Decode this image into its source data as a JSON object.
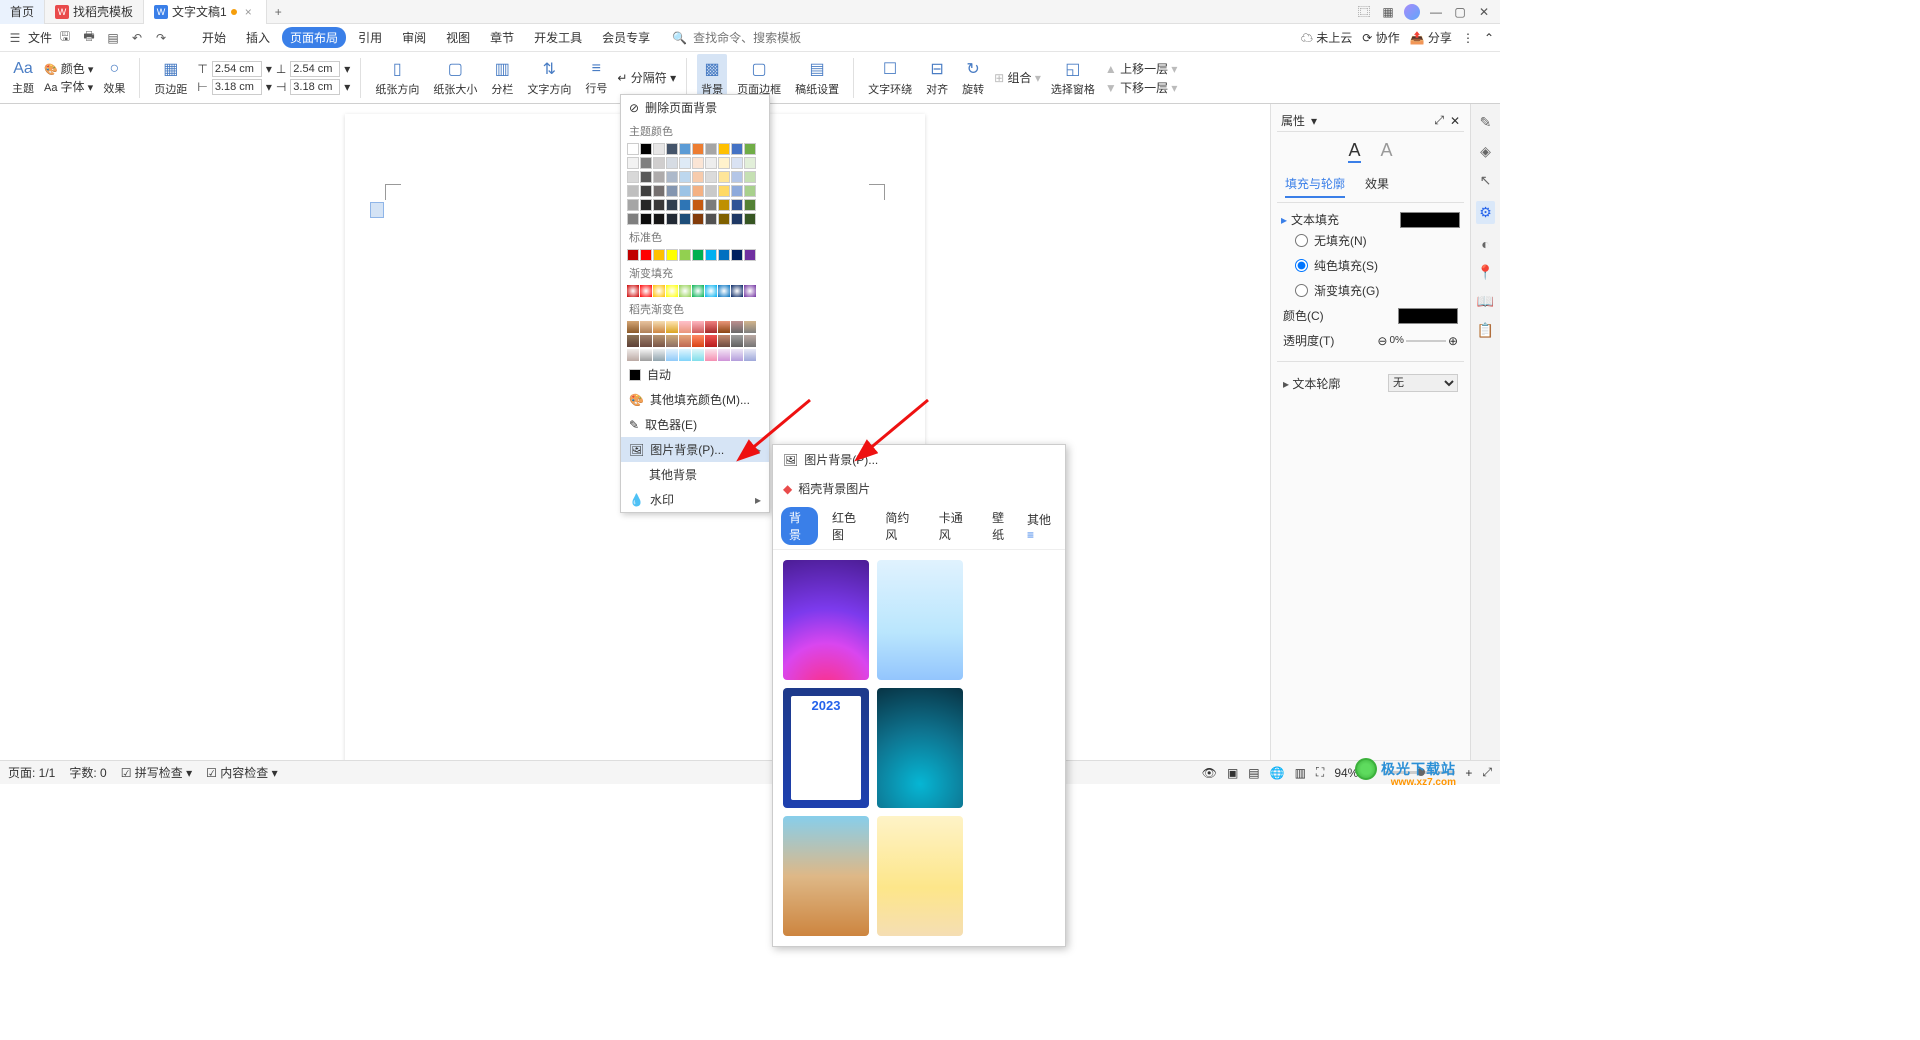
{
  "tabs": {
    "home": "首页",
    "template": "找稻壳模板",
    "doc": "文字文稿1"
  },
  "menu": {
    "file": "文件",
    "start": "开始",
    "insert": "插入",
    "layout": "页面布局",
    "ref": "引用",
    "review": "审阅",
    "view": "视图",
    "chapter": "章节",
    "dev": "开发工具",
    "member": "会员专享"
  },
  "search": {
    "cmd": "查找命令、搜索模板"
  },
  "cloud": {
    "nosave": "未上云",
    "collab": "协作",
    "share": "分享"
  },
  "ribbon": {
    "theme": "主题",
    "color": "颜色",
    "font": "字体",
    "effect": "效果",
    "margin": "页边距",
    "top": "2.54 cm",
    "bottom": "2.54 cm",
    "left": "3.18 cm",
    "right": "3.18 cm",
    "orient": "纸张方向",
    "size": "纸张大小",
    "columns": "分栏",
    "textdir": "文字方向",
    "lineno": "行号",
    "breaks": "分隔符",
    "bg": "背景",
    "border": "页面边框",
    "paper": "稿纸设置",
    "wrap": "文字环绕",
    "align": "对齐",
    "rotate": "旋转",
    "group": "组合",
    "pane": "选择窗格",
    "forward": "上移一层",
    "backward": "下移一层"
  },
  "bgmenu": {
    "delete": "删除页面背景",
    "theme": "主题颜色",
    "standard": "标准色",
    "gradient": "渐变填充",
    "docer": "稻壳渐变色",
    "auto": "自动",
    "more": "其他填充颜色(M)...",
    "picker": "取色器(E)",
    "image": "图片背景(P)...",
    "other": "其他背景",
    "watermark": "水印"
  },
  "submenu": {
    "image": "图片背景(P)...",
    "docer": "稻壳背景图片",
    "cat_bg": "背景",
    "cat_red": "红色图",
    "cat_simple": "简约风",
    "cat_cartoon": "卡通风",
    "cat_wall": "壁纸",
    "other": "其他",
    "year": "2023"
  },
  "panel": {
    "title": "属性",
    "tab_fill": "填充与轮廓",
    "tab_effect": "效果",
    "sect_fill": "文本填充",
    "r_none": "无填充(N)",
    "r_solid": "纯色填充(S)",
    "r_grad": "渐变填充(G)",
    "color": "颜色(C)",
    "trans": "透明度(T)",
    "trans_val": "0%",
    "sect_outline": "文本轮廓",
    "outline_none": "无"
  },
  "status": {
    "page": "页面: 1/1",
    "words": "字数: 0",
    "spell": "拼写检查",
    "content": "内容检查",
    "zoom": "94%",
    "minus": "−",
    "plus": "+"
  },
  "watermark": {
    "name": "极光下载站",
    "url": "www.xz7.com"
  }
}
